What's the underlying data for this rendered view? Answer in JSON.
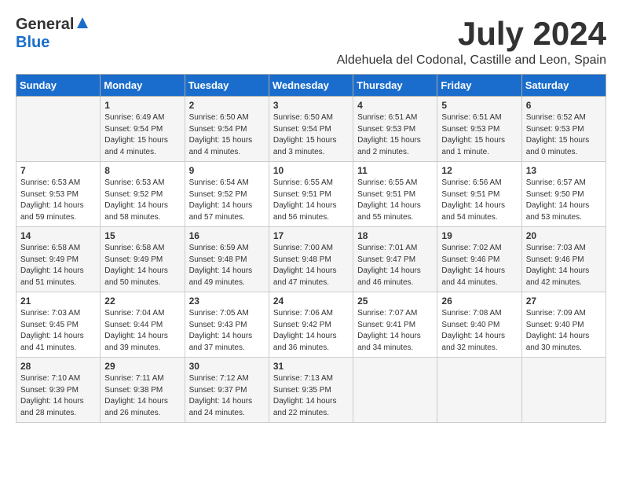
{
  "logo": {
    "general": "General",
    "blue": "Blue"
  },
  "title": "July 2024",
  "location": "Aldehuela del Codonal, Castille and Leon, Spain",
  "headers": [
    "Sunday",
    "Monday",
    "Tuesday",
    "Wednesday",
    "Thursday",
    "Friday",
    "Saturday"
  ],
  "weeks": [
    [
      {
        "day": "",
        "sunrise": "",
        "sunset": "",
        "daylight": ""
      },
      {
        "day": "1",
        "sunrise": "Sunrise: 6:49 AM",
        "sunset": "Sunset: 9:54 PM",
        "daylight": "Daylight: 15 hours and 4 minutes."
      },
      {
        "day": "2",
        "sunrise": "Sunrise: 6:50 AM",
        "sunset": "Sunset: 9:54 PM",
        "daylight": "Daylight: 15 hours and 4 minutes."
      },
      {
        "day": "3",
        "sunrise": "Sunrise: 6:50 AM",
        "sunset": "Sunset: 9:54 PM",
        "daylight": "Daylight: 15 hours and 3 minutes."
      },
      {
        "day": "4",
        "sunrise": "Sunrise: 6:51 AM",
        "sunset": "Sunset: 9:53 PM",
        "daylight": "Daylight: 15 hours and 2 minutes."
      },
      {
        "day": "5",
        "sunrise": "Sunrise: 6:51 AM",
        "sunset": "Sunset: 9:53 PM",
        "daylight": "Daylight: 15 hours and 1 minute."
      },
      {
        "day": "6",
        "sunrise": "Sunrise: 6:52 AM",
        "sunset": "Sunset: 9:53 PM",
        "daylight": "Daylight: 15 hours and 0 minutes."
      }
    ],
    [
      {
        "day": "7",
        "sunrise": "Sunrise: 6:53 AM",
        "sunset": "Sunset: 9:53 PM",
        "daylight": "Daylight: 14 hours and 59 minutes."
      },
      {
        "day": "8",
        "sunrise": "Sunrise: 6:53 AM",
        "sunset": "Sunset: 9:52 PM",
        "daylight": "Daylight: 14 hours and 58 minutes."
      },
      {
        "day": "9",
        "sunrise": "Sunrise: 6:54 AM",
        "sunset": "Sunset: 9:52 PM",
        "daylight": "Daylight: 14 hours and 57 minutes."
      },
      {
        "day": "10",
        "sunrise": "Sunrise: 6:55 AM",
        "sunset": "Sunset: 9:51 PM",
        "daylight": "Daylight: 14 hours and 56 minutes."
      },
      {
        "day": "11",
        "sunrise": "Sunrise: 6:55 AM",
        "sunset": "Sunset: 9:51 PM",
        "daylight": "Daylight: 14 hours and 55 minutes."
      },
      {
        "day": "12",
        "sunrise": "Sunrise: 6:56 AM",
        "sunset": "Sunset: 9:51 PM",
        "daylight": "Daylight: 14 hours and 54 minutes."
      },
      {
        "day": "13",
        "sunrise": "Sunrise: 6:57 AM",
        "sunset": "Sunset: 9:50 PM",
        "daylight": "Daylight: 14 hours and 53 minutes."
      }
    ],
    [
      {
        "day": "14",
        "sunrise": "Sunrise: 6:58 AM",
        "sunset": "Sunset: 9:49 PM",
        "daylight": "Daylight: 14 hours and 51 minutes."
      },
      {
        "day": "15",
        "sunrise": "Sunrise: 6:58 AM",
        "sunset": "Sunset: 9:49 PM",
        "daylight": "Daylight: 14 hours and 50 minutes."
      },
      {
        "day": "16",
        "sunrise": "Sunrise: 6:59 AM",
        "sunset": "Sunset: 9:48 PM",
        "daylight": "Daylight: 14 hours and 49 minutes."
      },
      {
        "day": "17",
        "sunrise": "Sunrise: 7:00 AM",
        "sunset": "Sunset: 9:48 PM",
        "daylight": "Daylight: 14 hours and 47 minutes."
      },
      {
        "day": "18",
        "sunrise": "Sunrise: 7:01 AM",
        "sunset": "Sunset: 9:47 PM",
        "daylight": "Daylight: 14 hours and 46 minutes."
      },
      {
        "day": "19",
        "sunrise": "Sunrise: 7:02 AM",
        "sunset": "Sunset: 9:46 PM",
        "daylight": "Daylight: 14 hours and 44 minutes."
      },
      {
        "day": "20",
        "sunrise": "Sunrise: 7:03 AM",
        "sunset": "Sunset: 9:46 PM",
        "daylight": "Daylight: 14 hours and 42 minutes."
      }
    ],
    [
      {
        "day": "21",
        "sunrise": "Sunrise: 7:03 AM",
        "sunset": "Sunset: 9:45 PM",
        "daylight": "Daylight: 14 hours and 41 minutes."
      },
      {
        "day": "22",
        "sunrise": "Sunrise: 7:04 AM",
        "sunset": "Sunset: 9:44 PM",
        "daylight": "Daylight: 14 hours and 39 minutes."
      },
      {
        "day": "23",
        "sunrise": "Sunrise: 7:05 AM",
        "sunset": "Sunset: 9:43 PM",
        "daylight": "Daylight: 14 hours and 37 minutes."
      },
      {
        "day": "24",
        "sunrise": "Sunrise: 7:06 AM",
        "sunset": "Sunset: 9:42 PM",
        "daylight": "Daylight: 14 hours and 36 minutes."
      },
      {
        "day": "25",
        "sunrise": "Sunrise: 7:07 AM",
        "sunset": "Sunset: 9:41 PM",
        "daylight": "Daylight: 14 hours and 34 minutes."
      },
      {
        "day": "26",
        "sunrise": "Sunrise: 7:08 AM",
        "sunset": "Sunset: 9:40 PM",
        "daylight": "Daylight: 14 hours and 32 minutes."
      },
      {
        "day": "27",
        "sunrise": "Sunrise: 7:09 AM",
        "sunset": "Sunset: 9:40 PM",
        "daylight": "Daylight: 14 hours and 30 minutes."
      }
    ],
    [
      {
        "day": "28",
        "sunrise": "Sunrise: 7:10 AM",
        "sunset": "Sunset: 9:39 PM",
        "daylight": "Daylight: 14 hours and 28 minutes."
      },
      {
        "day": "29",
        "sunrise": "Sunrise: 7:11 AM",
        "sunset": "Sunset: 9:38 PM",
        "daylight": "Daylight: 14 hours and 26 minutes."
      },
      {
        "day": "30",
        "sunrise": "Sunrise: 7:12 AM",
        "sunset": "Sunset: 9:37 PM",
        "daylight": "Daylight: 14 hours and 24 minutes."
      },
      {
        "day": "31",
        "sunrise": "Sunrise: 7:13 AM",
        "sunset": "Sunset: 9:35 PM",
        "daylight": "Daylight: 14 hours and 22 minutes."
      },
      {
        "day": "",
        "sunrise": "",
        "sunset": "",
        "daylight": ""
      },
      {
        "day": "",
        "sunrise": "",
        "sunset": "",
        "daylight": ""
      },
      {
        "day": "",
        "sunrise": "",
        "sunset": "",
        "daylight": ""
      }
    ]
  ]
}
